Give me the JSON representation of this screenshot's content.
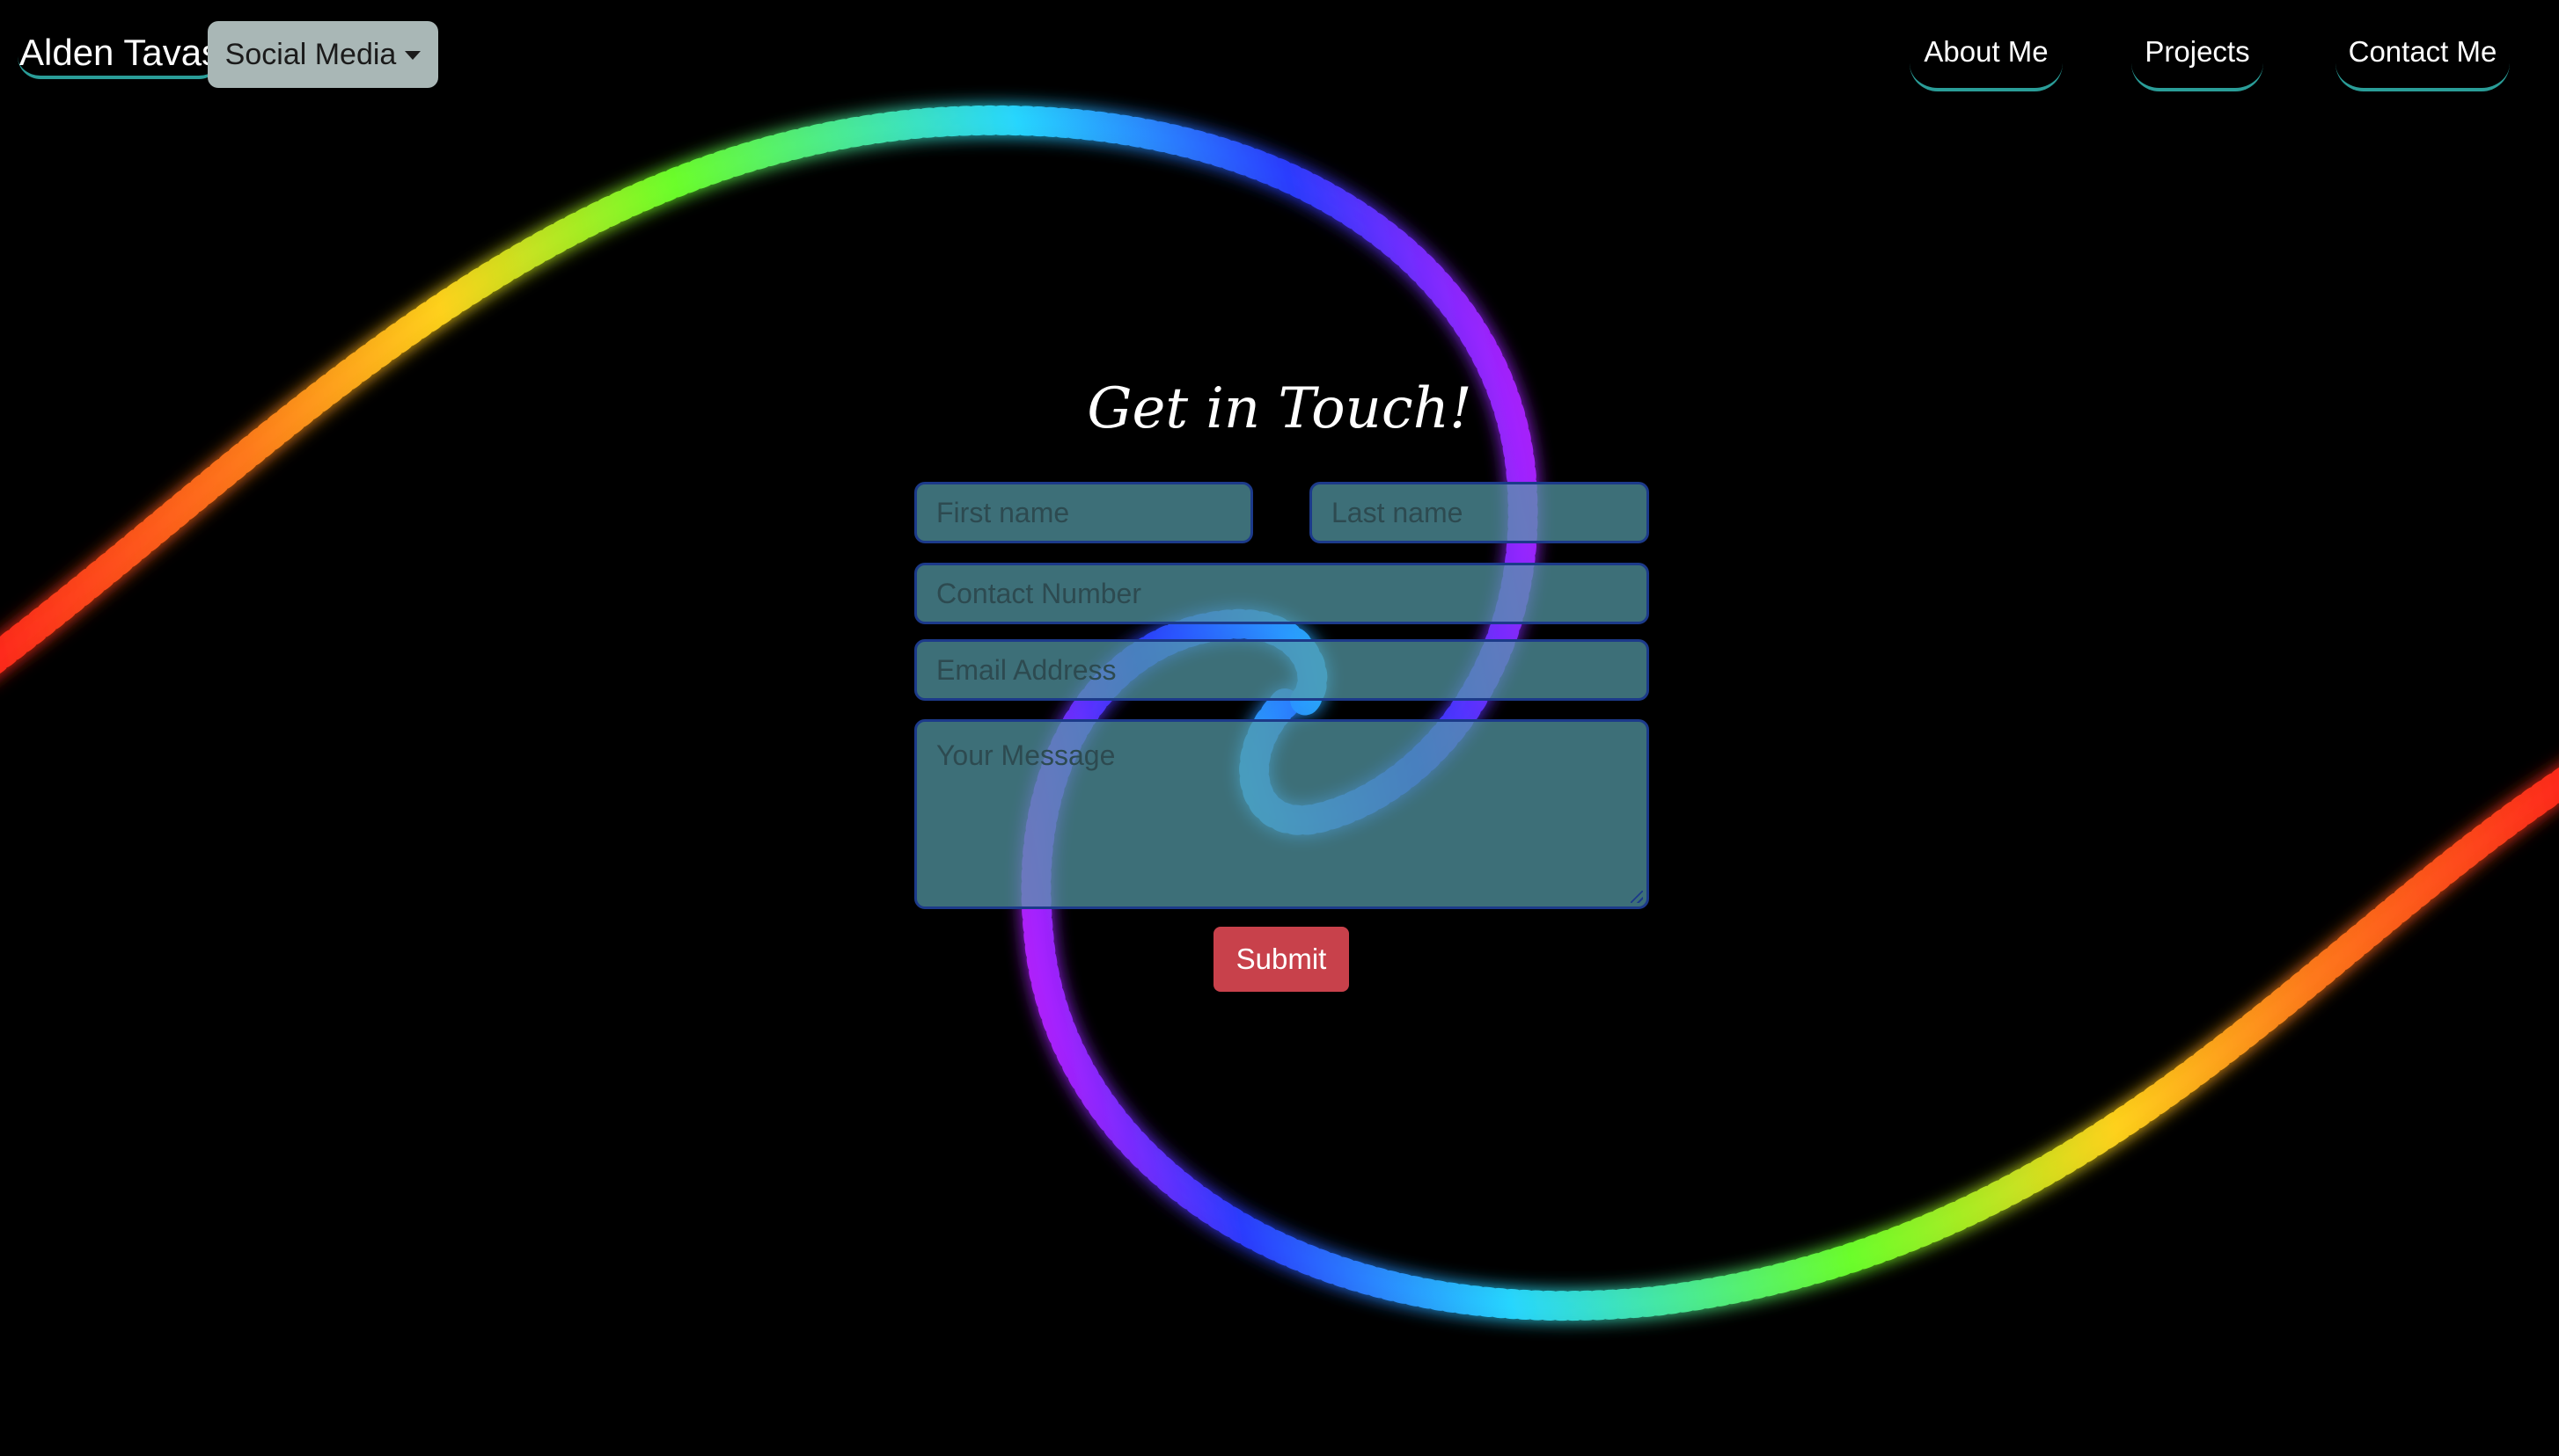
{
  "nav": {
    "brand": "Alden Tavas",
    "social_menu": "Social Media",
    "links": [
      {
        "label": "About Me"
      },
      {
        "label": "Projects"
      },
      {
        "label": "Contact Me"
      }
    ]
  },
  "contact": {
    "title": "Get in Touch!",
    "first_name_placeholder": "First name",
    "last_name_placeholder": "Last name",
    "phone_placeholder": "Contact Number",
    "email_placeholder": "Email Address",
    "message_placeholder": "Your Message",
    "submit_label": "Submit"
  },
  "colors": {
    "background": "#000000",
    "accent_underline": "#2a9d98",
    "field_fill": "#549aa6",
    "submit": "#c8414b",
    "dropdown": "#a9b7b6"
  }
}
